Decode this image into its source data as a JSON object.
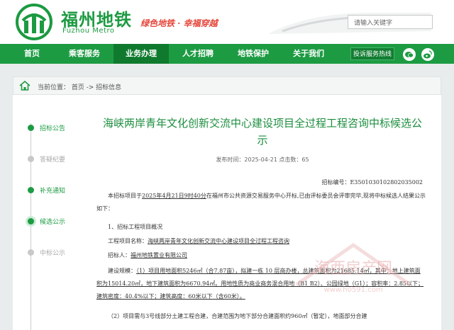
{
  "header": {
    "logo_cn": "福州地铁",
    "logo_en": "Fuzhou Metro",
    "slogan": "绿色地铁 · 幸福穿越",
    "search_placeholder": "请输入关键字"
  },
  "nav": {
    "items": [
      "首页",
      "乘客服务",
      "业务办理",
      "人才招聘",
      "地铁保护",
      "关于我们"
    ],
    "active_index": 2,
    "hotline": "投诉服务热线"
  },
  "breadcrumb": {
    "text": "当前位置： 首页 -> 招标信息"
  },
  "sidebar": {
    "items": [
      {
        "label": "招标公告",
        "state": "done"
      },
      {
        "label": "答疑纪要",
        "state": "inactive"
      },
      {
        "label": "补充通知",
        "state": "done"
      },
      {
        "label": "候选公示",
        "state": "current"
      },
      {
        "label": "中标公示",
        "state": "inactive"
      }
    ]
  },
  "article": {
    "title": "海峡两岸青年文化创新交流中心建设项目全过程工程咨询中标候选公示",
    "meta": "发布时间：2025-04-21 点击数：65",
    "bid_no": "招标编号：E3501030102802035002",
    "p1_a": "本招标项目于",
    "p1_date": "2025年4月21日9时40分",
    "p1_b": "在福州市公共资源交易服务中心开标,已由评标委员会评审完毕,现将中标候选人结果公示如下：",
    "p2": "1、招标工程项目概况",
    "p3_label": "工程项目名称：",
    "p3_value": "海峡两岸青年文化创新交流中心建设项目全过程工程咨询",
    "p4_label": "招标人：",
    "p4_value": "福州地铁置业有限公司",
    "p5_label": "建设规模：",
    "p5_value": "（1）项目用地面积5246㎡（合7.87亩），拟建一栋 10 层商办楼，总建筑面积为21685.14㎡，其中：地上建筑面积为15014.20㎡，地下建筑面积为6670.94㎡。用地性质为商业商务混合用地（B1 B2）、公园绿地（G1）；容积率：2.85以下；建筑密度：40.4%以下；建筑高度：60米以下（含60米）。",
    "p6": "（2）项目需与3号线部分土建工程合建，合建范围为地下部分合建面积约960㎡（暂定），地面部分合建"
  },
  "watermark": {
    "cn": "海西房产网",
    "url": "www.h0591.com"
  },
  "colors": {
    "brand_green": "#1d9b43",
    "nav_active": "#0f7a2e",
    "title_green": "#1c8e3e",
    "slogan_red": "#e5463a"
  }
}
